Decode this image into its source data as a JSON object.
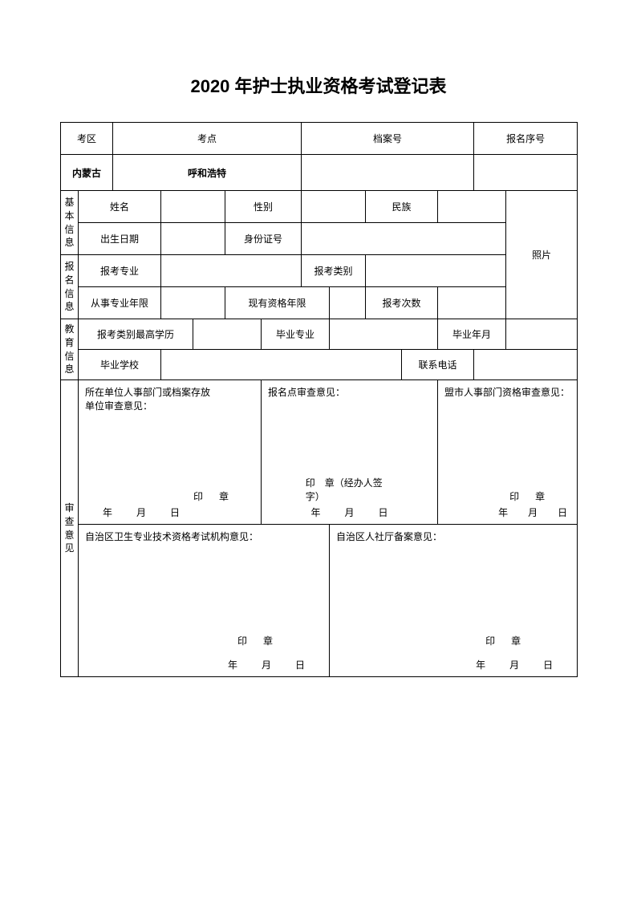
{
  "title": "2020 年护士执业资格考试登记表",
  "headers": {
    "exam_area": "考区",
    "exam_site": "考点",
    "file_no": "档案号",
    "reg_no": "报名序号"
  },
  "values": {
    "exam_area": "内蒙古",
    "exam_site": "呼和浩特"
  },
  "sections": {
    "basic": "基本信息",
    "reg": "报名信息",
    "edu": "教育信息",
    "review": "审查意见"
  },
  "basic": {
    "name": "姓名",
    "gender": "性别",
    "ethnicity": "民族",
    "birth": "出生日期",
    "id_no": "身份证号",
    "photo": "照片"
  },
  "reg_info": {
    "major": "报考专业",
    "category": "报考类别",
    "work_years": "从事专业年限",
    "qual_years": "现有资格年限",
    "exam_count": "报考次数"
  },
  "edu": {
    "highest": "报考类别最高学历",
    "grad_major": "毕业专业",
    "grad_date": "毕业年月",
    "school": "毕业学校",
    "phone": "联系电话"
  },
  "opinions": {
    "unit_line1": "所在单位人事部门或档案存放",
    "unit_line2": "单位审查意见：",
    "exam_site": "报名点审查意见：",
    "city": "盟市人事部门资格审查意见：",
    "region_exam": "自治区卫生专业技术资格考试机构意见：",
    "region_hr": "自治区人社厅备案意见：",
    "stamp": "印章",
    "stamp_sign": "印　章（经办人签字）",
    "date_y": "年",
    "date_m": "月",
    "date_d": "日"
  }
}
